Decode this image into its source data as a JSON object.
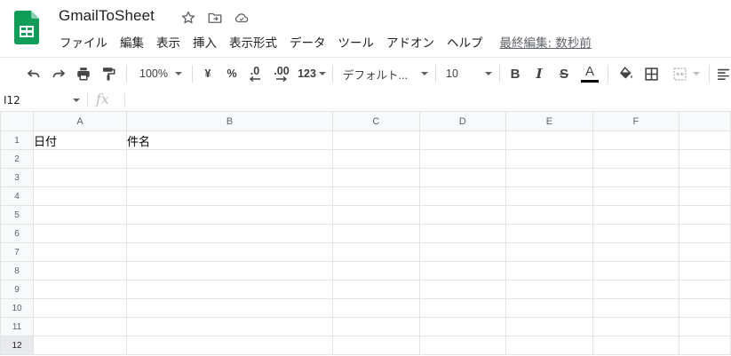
{
  "app": {
    "title": "GmailToSheet",
    "last_edit": "最終編集: 数秒前"
  },
  "menu": [
    "ファイル",
    "編集",
    "表示",
    "挿入",
    "表示形式",
    "データ",
    "ツール",
    "アドオン",
    "ヘルプ"
  ],
  "toolbar": {
    "zoom": "100%",
    "currency": "¥",
    "percent": "%",
    "decrease_decimal": ".0",
    "increase_decimal": ".00",
    "more_formats": "123",
    "font": "デフォルト...",
    "font_size": "10",
    "bold": "B",
    "italic": "I",
    "strike": "S",
    "text_color_letter": "A",
    "text_color": "#000000"
  },
  "formula_bar": {
    "cell_ref": "I12",
    "fx": "fx",
    "value": ""
  },
  "columns": [
    "A",
    "B",
    "C",
    "D",
    "E",
    "F"
  ],
  "rows": [
    "1",
    "2",
    "3",
    "4",
    "5",
    "6",
    "7",
    "8",
    "9",
    "10",
    "11",
    "12"
  ],
  "cells": {
    "A1": "日付",
    "B1": "件名"
  },
  "colors": {
    "sheets_green": "#0F9D58",
    "header_bg": "#f8f9fa",
    "gridline": "#e2e3e3"
  }
}
